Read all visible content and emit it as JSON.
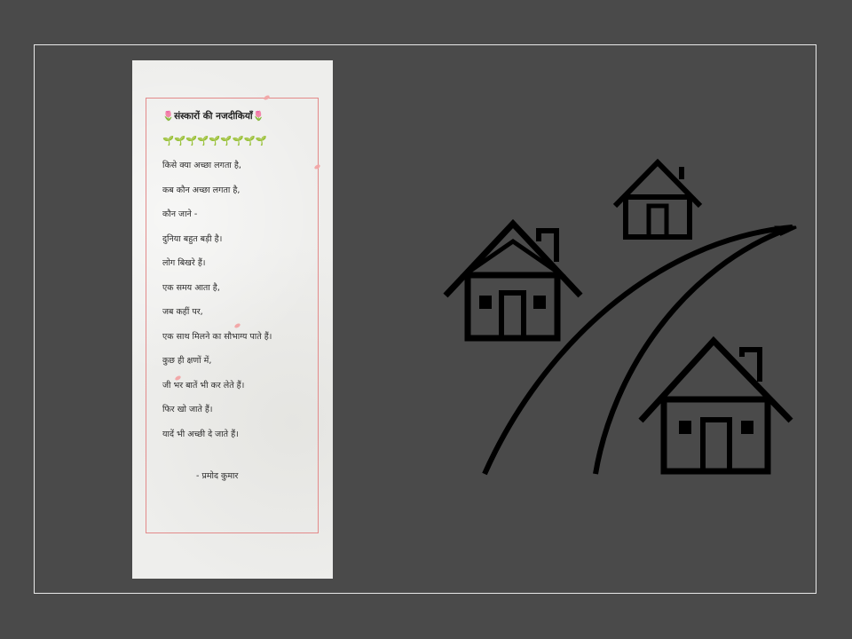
{
  "poem": {
    "title": "🌷संस्कारों की नजदीकियाँ🌷",
    "sprouts": "🌱🌱🌱🌱🌱🌱🌱🌱🌱",
    "lines": [
      "किसे क्या अच्छा लगता है,",
      "कब कौन अच्छा लगता है,",
      "कौन जाने -",
      "दुनिया बहुत बड़ी है।",
      "लोग बिखरे हैं।",
      "एक समय आता है,",
      "जब कहीं पर,",
      "एक साथ मिलने का सौभाग्य पाते हैं।",
      "कुछ ही क्षणों में,",
      "जी भर बातें भी कर लेते हैं।",
      "फिर खो जाते हैं।",
      "यादें भी अच्छी दे जाते हैं।"
    ],
    "author": "- प्रमोद कुमार"
  },
  "colors": {
    "background": "#4a4a4a",
    "frame_border": "#e9e9e9",
    "card": "#eeeeec",
    "card_border": "#e38a8a",
    "house_icon": "#000000"
  },
  "icons": {
    "houses": "houses-road-icon"
  }
}
